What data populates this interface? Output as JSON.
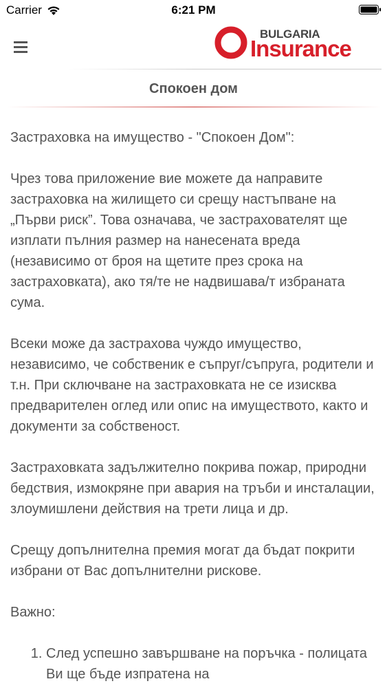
{
  "status_bar": {
    "carrier": "Carrier",
    "time": "6:21 PM",
    "icons": [
      "wifi-icon",
      "battery-icon"
    ]
  },
  "header": {
    "menu_icon": "hamburger-menu-icon",
    "logo_top": "BULGARIA",
    "logo_bottom": "Insurance",
    "logo_colors": {
      "red": "#d71f2a",
      "grey": "#444444"
    }
  },
  "page": {
    "title": "Спокоен дом"
  },
  "content": {
    "intro": "Застраховка на имущество - \"Спокоен Дом\":",
    "paragraphs": [
      "Чрез това приложение вие можете да направите застраховка на жилището си срещу настъпване на „Първи риск”. Това означава, че застрахователят ще изплати пълния размер на нанесената вреда (независимо от броя на щетите през срока на застраховката), ако тя/те не надвишава/т избраната сума.",
      "Всеки може да застрахова чуждо имущество, независимо, че собственик е съпруг/съпруга, родители и т.н. При сключване на застраховката не се изисква предварителен оглед или опис на имуществото, както и документи за собственост.",
      "Застраховката задължително покрива пожар, природни бедствия, измокряне при авария на тръби и инсталации, злоумишлени действия на трети лица и др.",
      "Срещу допълнителна премия могат да бъдат покрити избрани от Вас допълнителни рискове."
    ],
    "important_label": "Важно:",
    "list": [
      "След успешно завършване на поръчка - полицата Ви ще бъде изпратена на"
    ]
  }
}
